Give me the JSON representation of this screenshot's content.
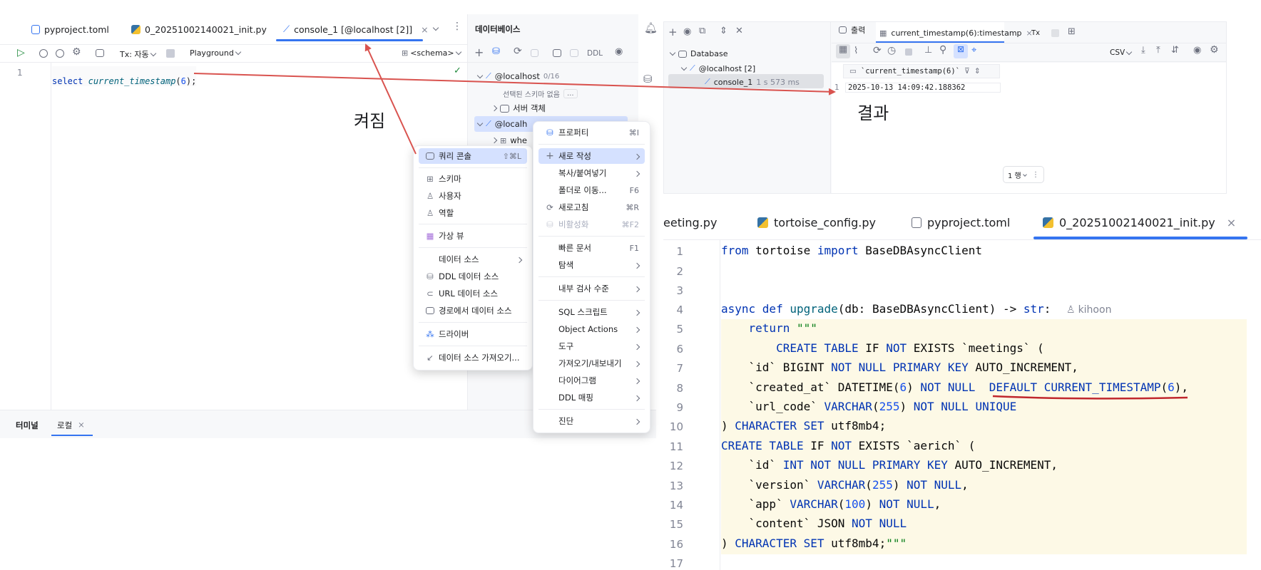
{
  "editor": {
    "tabs": [
      "pyproject.toml",
      "0_20251002140021_init.py",
      "console_1 [@localhost [2]]"
    ],
    "toolbar": {
      "tx": "Tx: 자동",
      "playground": "Playground",
      "schema": "<schema>"
    },
    "line_no": "1",
    "sql": {
      "kw": "select",
      "fn": "current_timestamp",
      "arg": "6",
      "tail": ";"
    }
  },
  "db_panel": {
    "title": "데이터베이스",
    "ddl": "DDL",
    "host1": "@localhost",
    "host1_badge": "0/16",
    "no_schema": "선택된 스키마 없음",
    "no_schema_more": "...",
    "server_objects": "서버 객체",
    "host2": "@localh",
    "where_item": "whe"
  },
  "menu_left": {
    "items": [
      {
        "label": "쿼리 콘솔",
        "shortcut": "⇧⌘L",
        "icon": "console-icon"
      },
      {
        "label": "스키마",
        "icon": "schema-icon"
      },
      {
        "label": "사용자",
        "icon": "user-icon"
      },
      {
        "label": "역할",
        "icon": "role-icon"
      },
      {
        "label": "가상 뷰",
        "icon": "virtual-view-icon"
      },
      {
        "label": "데이터 소스"
      },
      {
        "label": "DDL 데이터 소스",
        "icon": "ddl-datasource-icon"
      },
      {
        "label": "URL 데이터 소스",
        "icon": "url-datasource-icon"
      },
      {
        "label": "경로에서 데이터 소스",
        "icon": "folder-icon"
      },
      {
        "label": "드라이버",
        "icon": "driver-icon"
      },
      {
        "label": "데이터 소스 가져오기...",
        "icon": "import-icon"
      }
    ]
  },
  "menu_right": {
    "items": [
      {
        "label": "프로퍼티",
        "shortcut": "⌘I"
      },
      {
        "label": "새로 작성"
      },
      {
        "label": "복사/붙여넣기"
      },
      {
        "label": "폴더로 이동...",
        "shortcut": "F6"
      },
      {
        "label": "새로고침",
        "shortcut": "⌘R"
      },
      {
        "label": "비활성화",
        "shortcut": "⌘F2"
      },
      {
        "label": "빠른 문서",
        "shortcut": "F1"
      },
      {
        "label": "탐색"
      },
      {
        "label": "내부 검사 수준"
      },
      {
        "label": "SQL 스크립트"
      },
      {
        "label": "Object Actions"
      },
      {
        "label": "도구"
      },
      {
        "label": "가져오기/내보내기"
      },
      {
        "label": "다이어그램"
      },
      {
        "label": "DDL 매핑"
      },
      {
        "label": "진단"
      }
    ]
  },
  "bottom": {
    "terminal": "터미널",
    "local": "로컬"
  },
  "annotations": {
    "turned_on": "켜짐",
    "result": "결과"
  },
  "services": {
    "tree": {
      "root": "Database",
      "host": "@localhost [2]",
      "console": "console_1",
      "console_time": "1 s 573 ms"
    },
    "tabs": [
      "출력",
      "current_timestamp(6):timestamp",
      "Tx"
    ],
    "csv": "CSV",
    "column": "`current_timestamp(6)`",
    "row_no": "1",
    "value": "2025-10-13 14:09:42.188362",
    "rows": "1 행"
  },
  "code_editor": {
    "tabs": [
      "eeting.py",
      "tortoise_config.py",
      "pyproject.toml",
      "0_20251002140021_init.py"
    ],
    "author": "kihoon",
    "lines": [
      "1",
      "2",
      "3",
      "4",
      "5",
      "6",
      "7",
      "8",
      "9",
      "10",
      "11",
      "12",
      "13",
      "14",
      "15",
      "16",
      "17"
    ]
  }
}
